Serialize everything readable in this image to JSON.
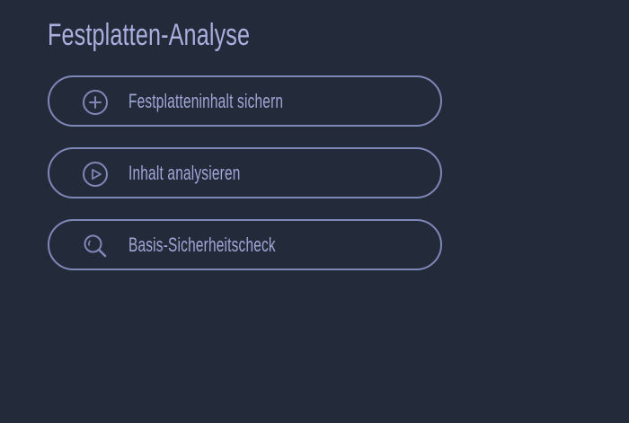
{
  "page": {
    "title": "Festplatten-Analyse"
  },
  "actions": [
    {
      "label": "Festplatteninhalt sichern",
      "icon": "plus-circle-icon"
    },
    {
      "label": "Inhalt analysieren",
      "icon": "play-circle-icon"
    },
    {
      "label": "Basis-Sicherheitscheck",
      "icon": "search-icon"
    }
  ],
  "colors": {
    "background": "#232a3a",
    "accent": "#7f87b6",
    "text": "#a0a7d6"
  }
}
